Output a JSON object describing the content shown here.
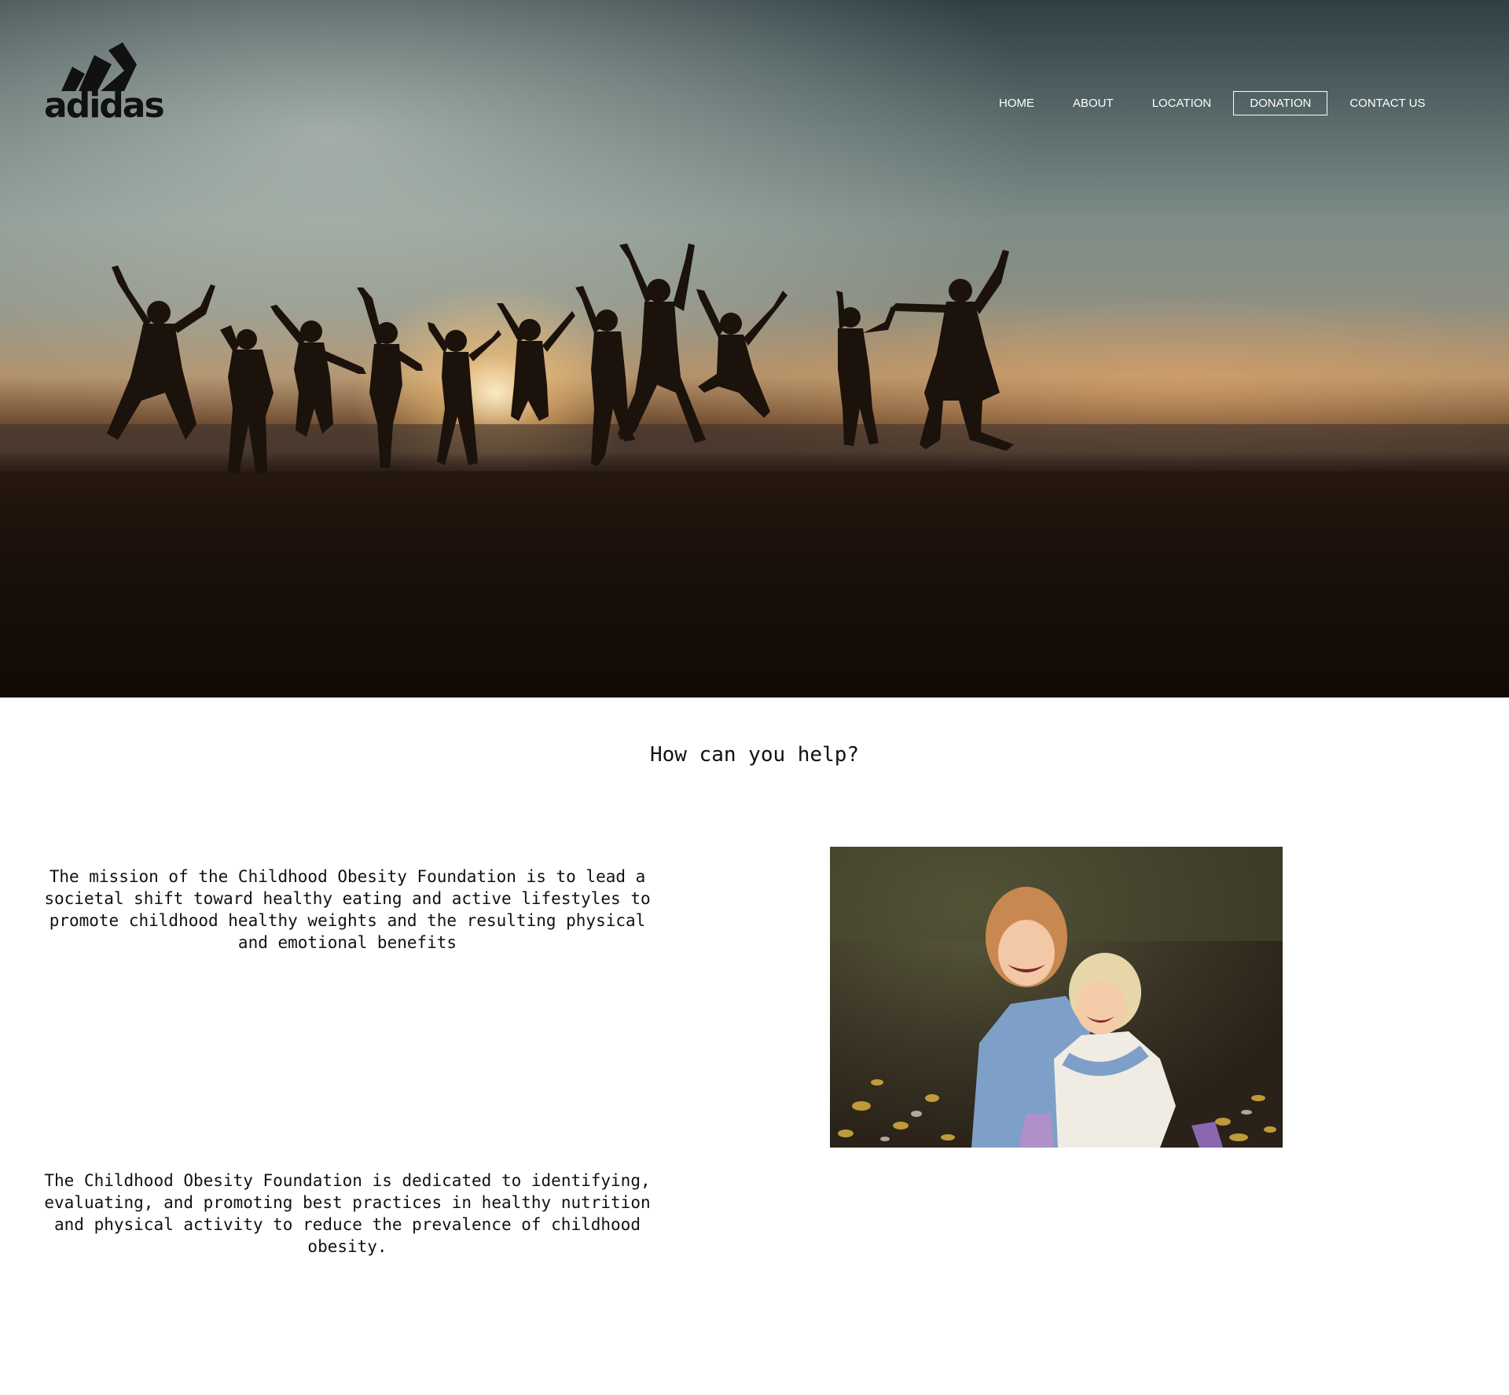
{
  "brand": {
    "logo_text": "adidas"
  },
  "nav": {
    "items": [
      {
        "label": "HOME",
        "active": false
      },
      {
        "label": "ABOUT",
        "active": false
      },
      {
        "label": "LOCATION",
        "active": false
      },
      {
        "label": "DONATION",
        "active": true
      },
      {
        "label": "CONTACT US",
        "active": false
      }
    ]
  },
  "hero": {
    "image": "silhouette-people-jumping-at-beach-sunset"
  },
  "main": {
    "title": "How can you help?",
    "paragraph_1": "The mission of the Childhood Obesity Foundation is to lead a societal shift toward healthy eating and active lifestyles to promote childhood healthy weights and the resulting physical and emotional benefits",
    "paragraph_2": "The Childhood Obesity Foundation is dedicated to identifying, evaluating, and promoting best practices in healthy nutrition and physical activity to reduce the prevalence of childhood obesity.",
    "photo": "two-girls-hugging-outdoors"
  },
  "colors": {
    "nav_text": "#ffffff",
    "body_text": "#111111",
    "background": "#ffffff"
  }
}
